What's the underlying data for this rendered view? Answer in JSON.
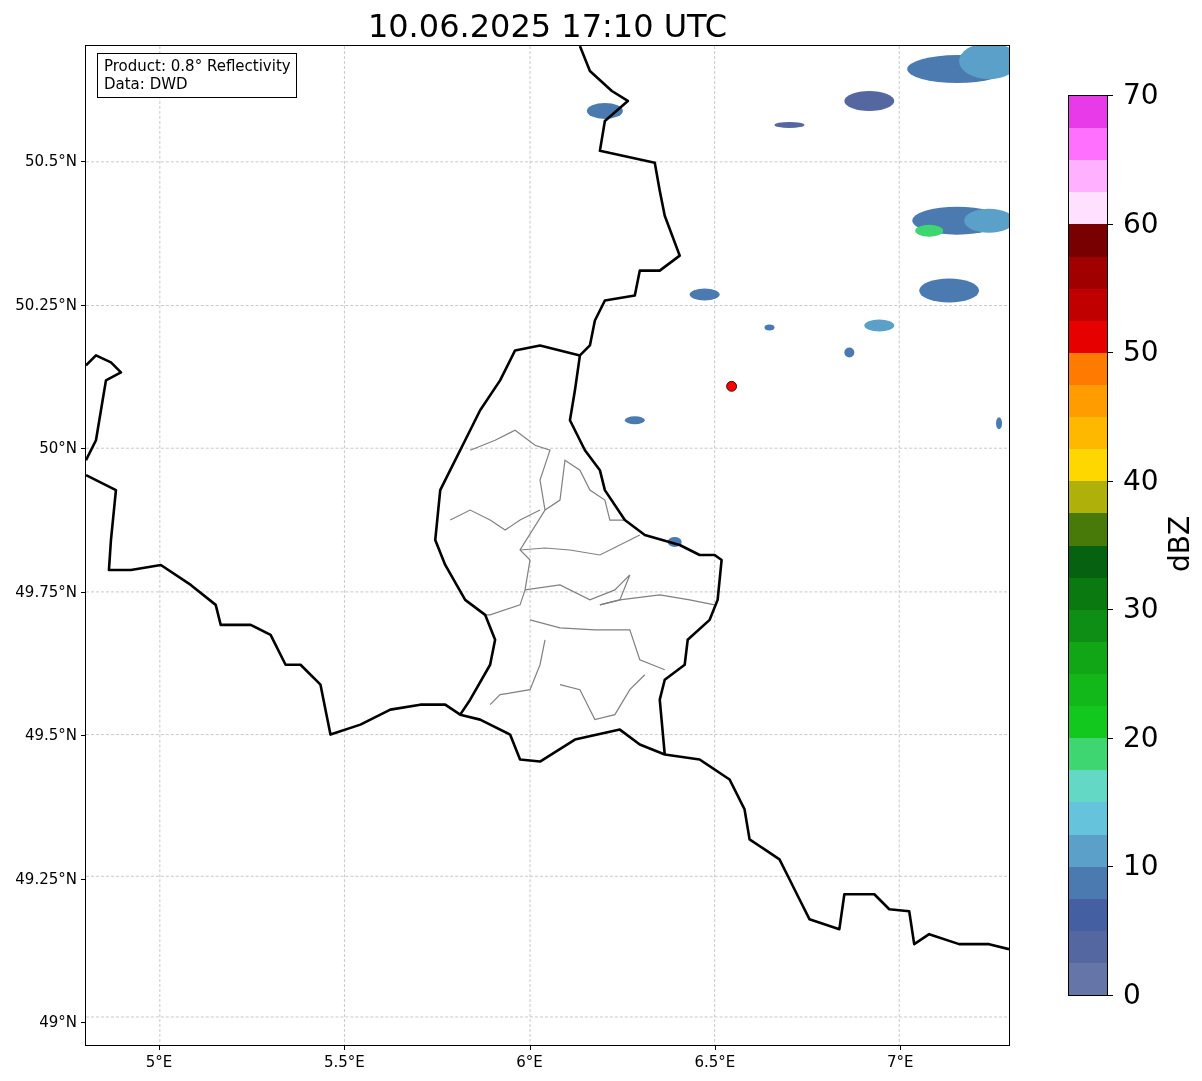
{
  "title": "10.06.2025 17:10 UTC",
  "info_box": {
    "lines": [
      "Product: 0.8° Reflectivity",
      "Data: DWD"
    ]
  },
  "map": {
    "x_ticks": [
      "5°E",
      "5.5°E",
      "6°E",
      "6.5°E",
      "7°E"
    ],
    "y_ticks": [
      "50.5°N",
      "50.25°N",
      "50°N",
      "49.75°N",
      "49.5°N",
      "49.25°N",
      "49°N"
    ]
  },
  "colorbar": {
    "label": "dBZ",
    "ticks": [
      "70",
      "60",
      "50",
      "40",
      "30",
      "20",
      "10",
      "0"
    ],
    "segments": [
      {
        "color": "#e83ae8"
      },
      {
        "color": "#ff70ff"
      },
      {
        "color": "#ffb0ff"
      },
      {
        "color": "#ffe0ff"
      },
      {
        "color": "#780000"
      },
      {
        "color": "#a00000"
      },
      {
        "color": "#c00000"
      },
      {
        "color": "#e60000"
      },
      {
        "color": "#ff7a00"
      },
      {
        "color": "#ff9c00"
      },
      {
        "color": "#ffb800"
      },
      {
        "color": "#ffd700"
      },
      {
        "color": "#b0b00a"
      },
      {
        "color": "#487a0a"
      },
      {
        "color": "#066210"
      },
      {
        "color": "#0a7a10"
      },
      {
        "color": "#0e8e14"
      },
      {
        "color": "#10a616"
      },
      {
        "color": "#12b81a"
      },
      {
        "color": "#12c81e"
      },
      {
        "color": "#3ed670"
      },
      {
        "color": "#62d8c5"
      },
      {
        "color": "#66c3dc"
      },
      {
        "color": "#5aa0c8"
      },
      {
        "color": "#4a7ab0"
      },
      {
        "color": "#4460a3"
      },
      {
        "color": "#5567a0"
      },
      {
        "color": "#6675a8"
      }
    ]
  }
}
